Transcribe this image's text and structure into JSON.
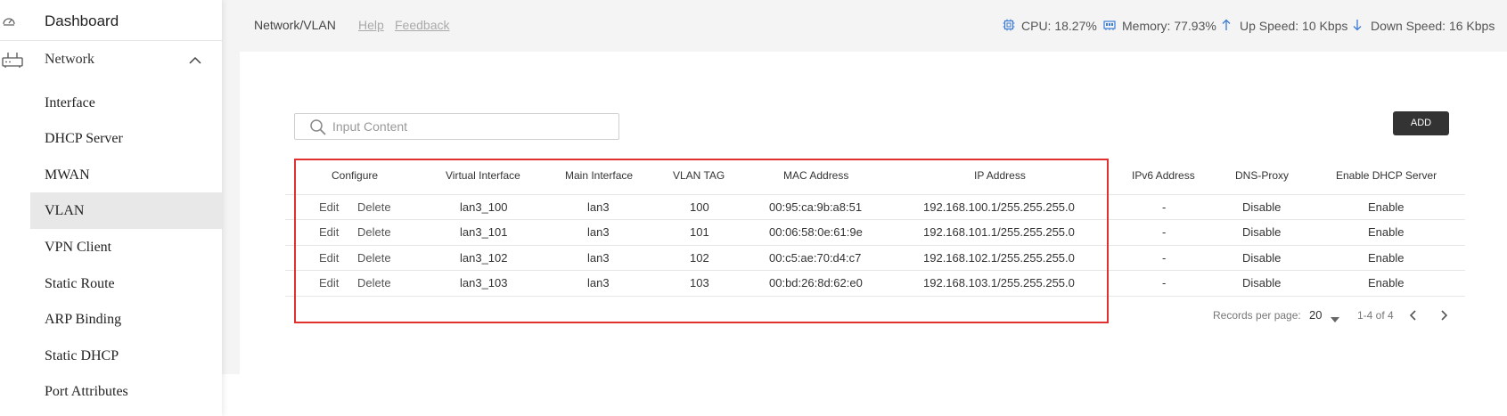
{
  "sidebar": {
    "dashboard": "Dashboard",
    "network": "Network",
    "items": [
      {
        "label": "Interface"
      },
      {
        "label": "DHCP Server"
      },
      {
        "label": "MWAN"
      },
      {
        "label": "VLAN",
        "active": true
      },
      {
        "label": "VPN Client"
      },
      {
        "label": "Static Route"
      },
      {
        "label": "ARP Binding"
      },
      {
        "label": "Static DHCP"
      },
      {
        "label": "Port Attributes"
      }
    ]
  },
  "header": {
    "breadcrumb": "Network/VLAN",
    "help": "Help",
    "feedback": "Feedback",
    "cpu": "CPU: 18.27%",
    "memory": "Memory: 77.93%",
    "up_speed": "Up Speed: 10 Kbps",
    "down_speed": "Down Speed: 16 Kbps"
  },
  "search": {
    "placeholder": "Input Content"
  },
  "add_label": "ADD",
  "table": {
    "columns": [
      "Configure",
      "Virtual Interface",
      "Main Interface",
      "VLAN TAG",
      "MAC Address",
      "IP Address",
      "IPv6 Address",
      "DNS-Proxy",
      "Enable DHCP Server"
    ],
    "edit_label": "Edit",
    "delete_label": "Delete",
    "rows": [
      {
        "virtual": "lan3_100",
        "main": "lan3",
        "tag": "100",
        "mac": "00:95:ca:9b:a8:51",
        "ip": "192.168.100.1/255.255.255.0",
        "ipv6": "-",
        "dns": "Disable",
        "dhcp": "Enable"
      },
      {
        "virtual": "lan3_101",
        "main": "lan3",
        "tag": "101",
        "mac": "00:06:58:0e:61:9e",
        "ip": "192.168.101.1/255.255.255.0",
        "ipv6": "-",
        "dns": "Disable",
        "dhcp": "Enable"
      },
      {
        "virtual": "lan3_102",
        "main": "lan3",
        "tag": "102",
        "mac": "00:c5:ae:70:d4:c7",
        "ip": "192.168.102.1/255.255.255.0",
        "ipv6": "-",
        "dns": "Disable",
        "dhcp": "Enable"
      },
      {
        "virtual": "lan3_103",
        "main": "lan3",
        "tag": "103",
        "mac": "00:bd:26:8d:62:e0",
        "ip": "192.168.103.1/255.255.255.0",
        "ipv6": "-",
        "dns": "Disable",
        "dhcp": "Enable"
      }
    ]
  },
  "pagination": {
    "records_label": "Records per page:",
    "page_size": "20",
    "range": "1-4 of 4"
  },
  "colors": {
    "highlight": "#e03030",
    "icon_blue": "#3a7bd5",
    "add_button": "#333333"
  }
}
